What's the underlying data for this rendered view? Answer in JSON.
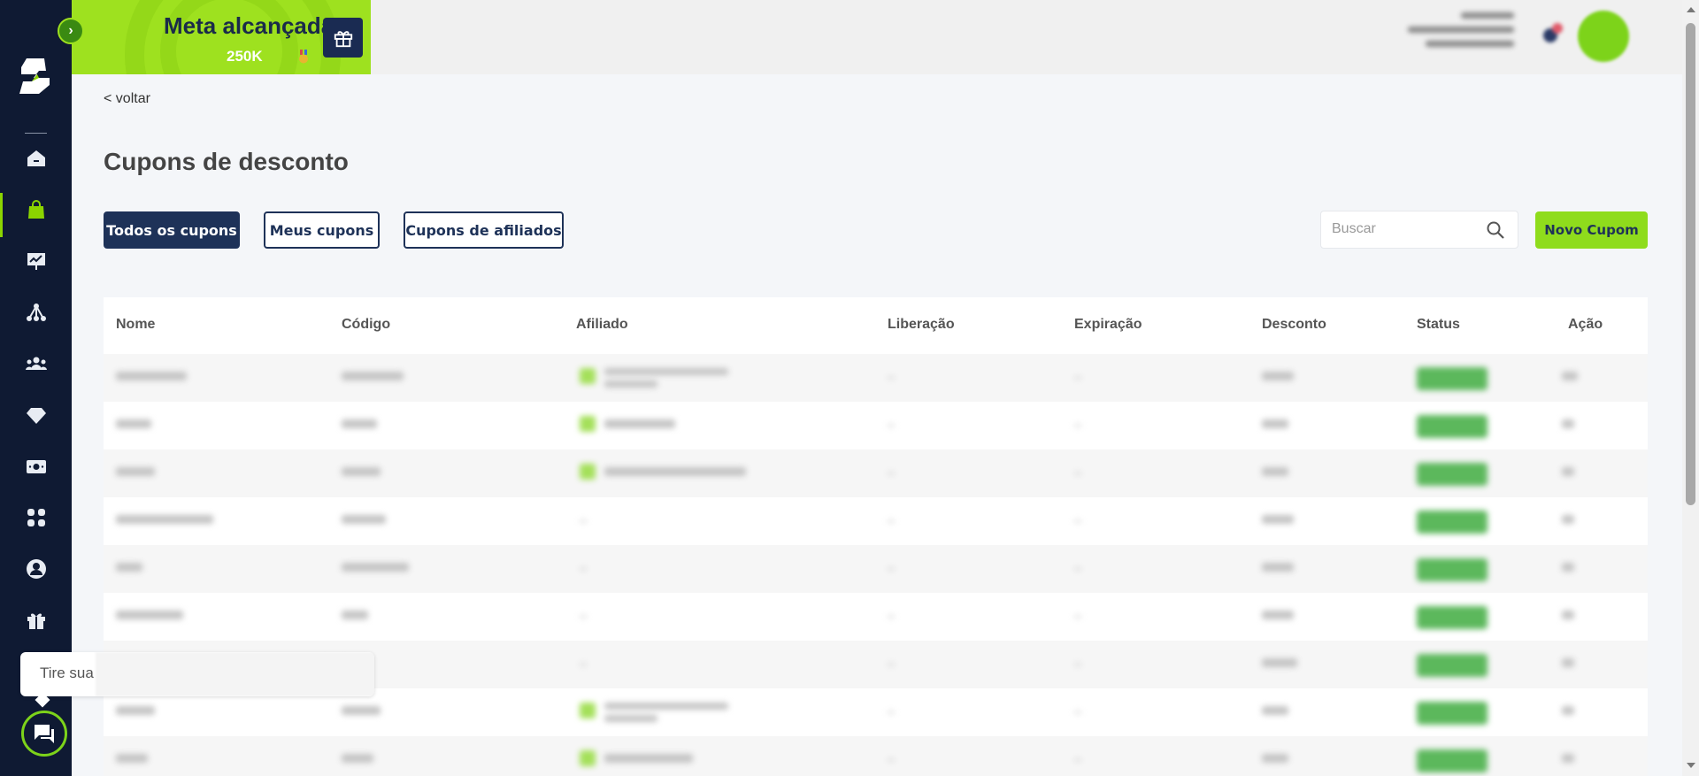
{
  "goal_banner": {
    "title": "Meta alcançada!",
    "value": "250K",
    "toggle_icon": "chevron-right-icon",
    "gift_icon": "gift-icon"
  },
  "sidebar": {
    "items": [
      {
        "name": "home",
        "icon": "home-icon",
        "active": false
      },
      {
        "name": "products",
        "icon": "shopping-bag-icon",
        "active": true
      },
      {
        "name": "sales",
        "icon": "presentation-chart-icon",
        "active": false
      },
      {
        "name": "affiliates",
        "icon": "network-icon",
        "active": false
      },
      {
        "name": "members",
        "icon": "users-icon",
        "active": false
      },
      {
        "name": "premium",
        "icon": "diamond-icon",
        "active": false
      },
      {
        "name": "finance",
        "icon": "money-icon",
        "active": false
      },
      {
        "name": "apps",
        "icon": "grid-icon",
        "active": false
      },
      {
        "name": "account",
        "icon": "user-circle-icon",
        "active": false
      },
      {
        "name": "rewards",
        "icon": "gift-icon",
        "active": false
      }
    ]
  },
  "header": {
    "notification_icon": "bell-icon",
    "avatar_icon": "avatar"
  },
  "page": {
    "back_label": "< voltar",
    "title": "Cupons de desconto"
  },
  "tabs": [
    {
      "label": "Todos os cupons",
      "active": true
    },
    {
      "label": "Meus cupons",
      "active": false
    },
    {
      "label": "Cupons de afiliados",
      "active": false
    }
  ],
  "search": {
    "placeholder": "Buscar"
  },
  "new_coupon_label": "Novo Cupom",
  "table": {
    "columns": [
      "Nome",
      "Código",
      "Afiliado",
      "Liberação",
      "Expiração",
      "Desconto",
      "Status",
      "Ação"
    ],
    "row_count": 9
  },
  "chat": {
    "tip_text": "Tire sua",
    "icon": "chat-icon"
  },
  "colors": {
    "sidebar_bg": "#0f1a33",
    "accent_green": "#8fdc1c",
    "navy": "#1e3258",
    "status_green": "#5cb85c"
  }
}
